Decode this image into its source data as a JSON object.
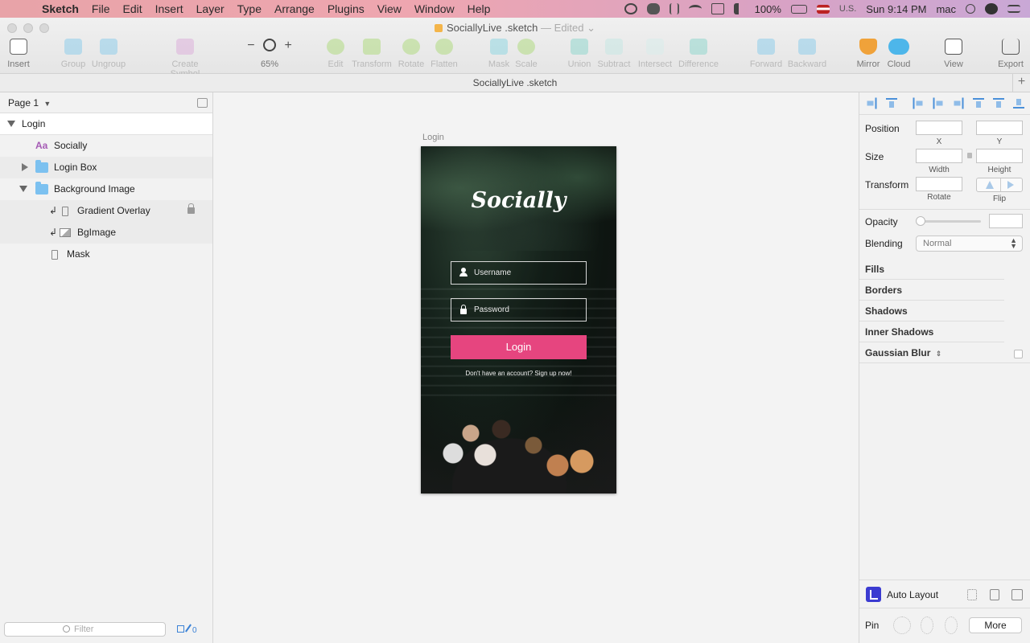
{
  "menubar": {
    "app_name": "Sketch",
    "items": [
      "File",
      "Edit",
      "Insert",
      "Layer",
      "Type",
      "Arrange",
      "Plugins",
      "View",
      "Window",
      "Help"
    ],
    "battery": "100%",
    "input_source": "U.S.",
    "clock": "Sun 9:14 PM",
    "user": "mac"
  },
  "window": {
    "title": "SociallyLive .sketch",
    "title_suffix": "— Edited",
    "tab_name": "SociallyLive .sketch"
  },
  "toolbar": {
    "insert": "Insert",
    "group": "Group",
    "ungroup": "Ungroup",
    "create_symbol": "Create Symbol",
    "zoom_minus": "−",
    "zoom_plus": "+",
    "zoom_value": "65%",
    "edit": "Edit",
    "transform": "Transform",
    "rotate": "Rotate",
    "flatten": "Flatten",
    "mask": "Mask",
    "scale": "Scale",
    "union": "Union",
    "subtract": "Subtract",
    "intersect": "Intersect",
    "difference": "Difference",
    "forward": "Forward",
    "backward": "Backward",
    "mirror": "Mirror",
    "cloud": "Cloud",
    "view": "View",
    "export": "Export"
  },
  "layers": {
    "page": "Page 1",
    "artboard": "Login",
    "items": [
      {
        "name": "Socially",
        "type": "text"
      },
      {
        "name": "Login Box",
        "type": "group"
      },
      {
        "name": "Background Image",
        "type": "group"
      },
      {
        "name": "Gradient Overlay",
        "type": "rectangle"
      },
      {
        "name": "BgImage",
        "type": "image"
      },
      {
        "name": "Mask",
        "type": "rectangle"
      }
    ],
    "filter_placeholder": "Filter",
    "filter_count": "0"
  },
  "artboard": {
    "label": "Login",
    "logo": "Socially",
    "username_placeholder": "Username",
    "password_placeholder": "Password",
    "login_button": "Login",
    "signup_text": "Don't have an account? Sign up now!",
    "login_button_color": "#e6457f"
  },
  "inspector": {
    "position": "Position",
    "x": "X",
    "y": "Y",
    "size": "Size",
    "width": "Width",
    "height": "Height",
    "transform": "Transform",
    "rotate": "Rotate",
    "flip": "Flip",
    "opacity": "Opacity",
    "blending": "Blending",
    "blending_value": "Normal",
    "sections": [
      "Fills",
      "Borders",
      "Shadows",
      "Inner Shadows",
      "Gaussian Blur"
    ],
    "auto_layout": "Auto Layout",
    "pin": "Pin",
    "more": "More"
  }
}
